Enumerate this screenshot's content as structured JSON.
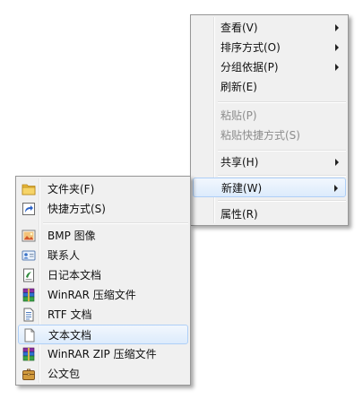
{
  "main_menu": {
    "items": [
      {
        "label": "查看(V)"
      },
      {
        "label": "排序方式(O)"
      },
      {
        "label": "分组依据(P)"
      },
      {
        "label": "刷新(E)"
      },
      {
        "label": "粘贴(P)"
      },
      {
        "label": "粘贴快捷方式(S)"
      },
      {
        "label": "共享(H)"
      },
      {
        "label": "新建(W)"
      },
      {
        "label": "属性(R)"
      }
    ]
  },
  "sub_menu": {
    "items": [
      {
        "label": "文件夹(F)",
        "icon": "folder-icon"
      },
      {
        "label": "快捷方式(S)",
        "icon": "shortcut-icon"
      },
      {
        "label": "BMP 图像",
        "icon": "bmp-image-icon"
      },
      {
        "label": "联系人",
        "icon": "contact-icon"
      },
      {
        "label": "日记本文档",
        "icon": "journal-icon"
      },
      {
        "label": "WinRAR 压缩文件",
        "icon": "winrar-icon"
      },
      {
        "label": "RTF 文档",
        "icon": "rtf-document-icon"
      },
      {
        "label": "文本文档",
        "icon": "text-document-icon"
      },
      {
        "label": "WinRAR ZIP 压缩文件",
        "icon": "winrar-zip-icon"
      },
      {
        "label": "公文包",
        "icon": "briefcase-icon"
      }
    ]
  }
}
